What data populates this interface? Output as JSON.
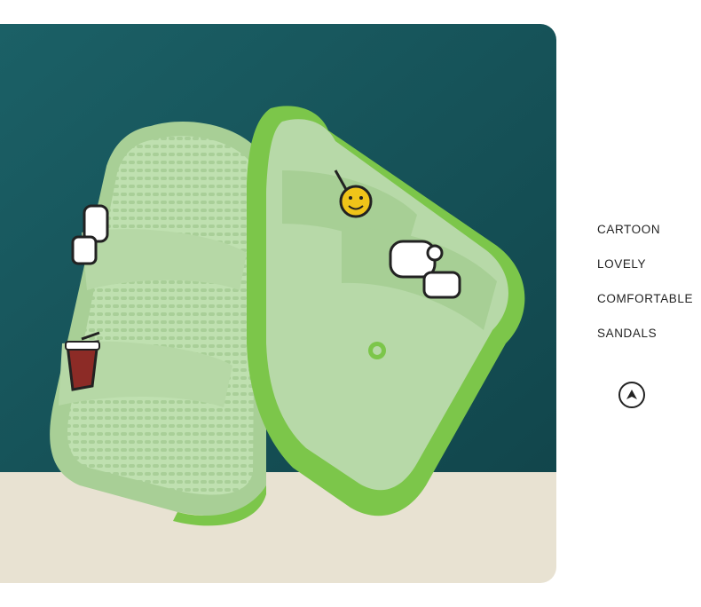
{
  "product_photo": {
    "colors": {
      "wall": "#17545a",
      "floor": "#e8e2d2",
      "sandal_upper": "#b7d9a8",
      "sandal_sole": "#7cc64a"
    }
  },
  "feature_words": [
    "CARTOON",
    "LOVELY",
    "COMFORTABLE",
    "SANDALS"
  ],
  "scroll_button": {
    "icon": "up-arrow-icon"
  }
}
